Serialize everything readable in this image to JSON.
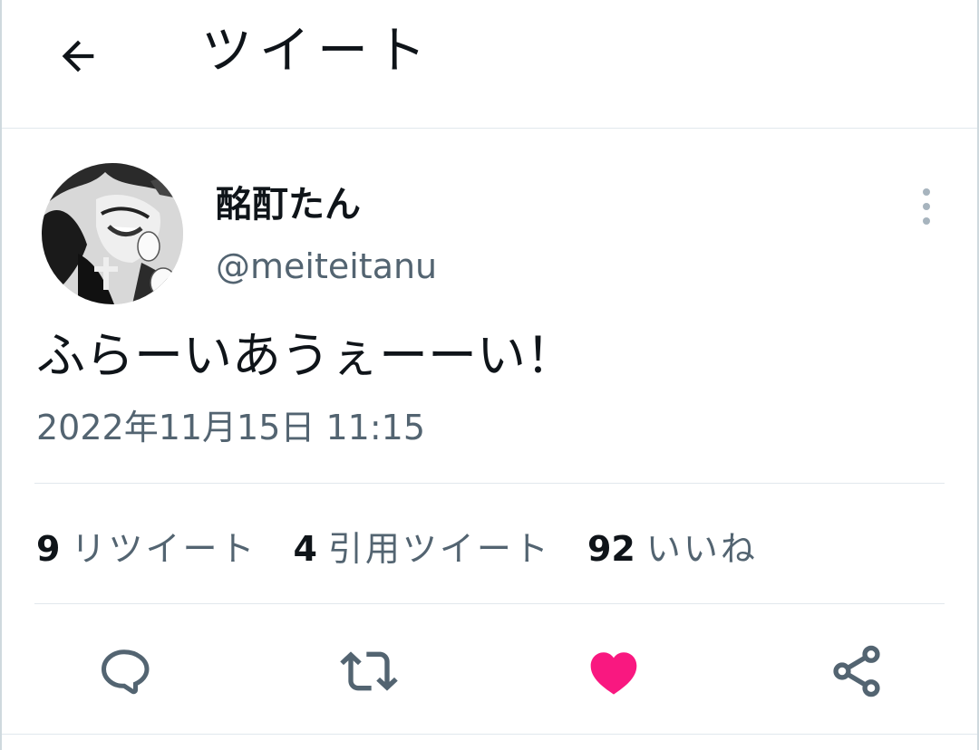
{
  "header": {
    "title": "ツイート",
    "back_icon": "arrow-left-icon"
  },
  "author": {
    "display_name": "酩酊たん",
    "handle": "@meiteitanu",
    "avatar": "manga-character-avatar"
  },
  "tweet": {
    "text": "ふらーいあうぇーーい！",
    "timestamp": "2022年11月15日 11:15"
  },
  "stats": [
    {
      "count": "9",
      "label": "リツイート"
    },
    {
      "count": "4",
      "label": "引用ツイート"
    },
    {
      "count": "92",
      "label": "いいね"
    }
  ],
  "actions": {
    "reply_icon": "reply-icon",
    "retweet_icon": "retweet-icon",
    "like_icon": "heart-icon",
    "share_icon": "share-icon",
    "like_color": "#f91880",
    "icon_color": "#536471"
  },
  "colors": {
    "text": "#0f1419",
    "secondary": "#536471",
    "divider": "#e1e8ed"
  }
}
